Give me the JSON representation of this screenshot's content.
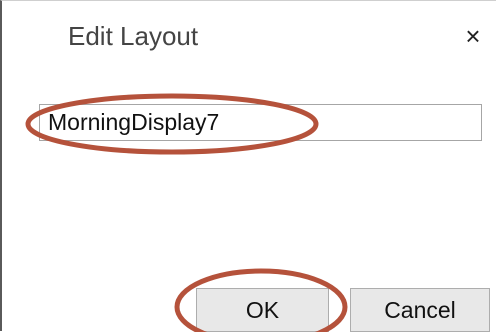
{
  "dialog": {
    "title": "Edit Layout",
    "close_glyph": "×"
  },
  "form": {
    "layout_name_value": "MorningDisplay7"
  },
  "buttons": {
    "ok_label": "OK",
    "cancel_label": "Cancel"
  },
  "icons": {
    "close": "close-icon"
  },
  "colors": {
    "annotation_outline": "#b5523b",
    "button_face": "#e8e8e8",
    "border": "#adadad"
  }
}
